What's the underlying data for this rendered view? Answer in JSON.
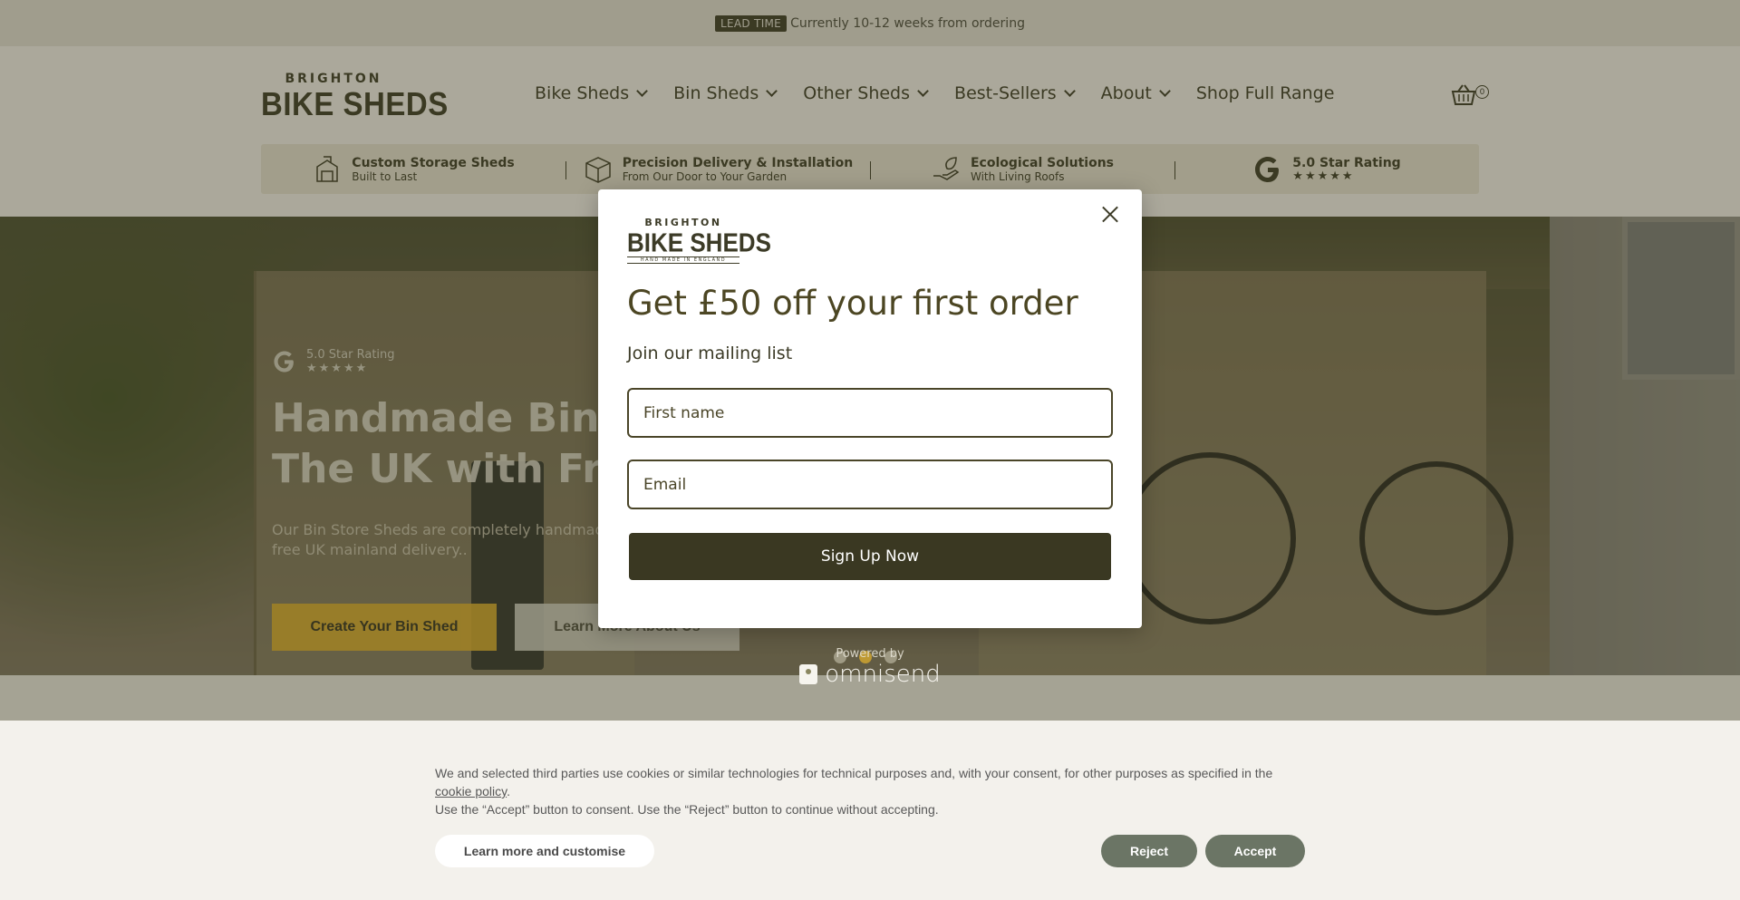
{
  "topbar": {
    "badge": "LEAD TIME",
    "text": "Currently 10-12 weeks from ordering"
  },
  "logo": {
    "small": "BRIGHTON",
    "big": "BIKE SHEDS"
  },
  "nav": {
    "items": [
      {
        "label": "Bike Sheds",
        "has_dropdown": true
      },
      {
        "label": "Bin Sheds",
        "has_dropdown": true
      },
      {
        "label": "Other Sheds",
        "has_dropdown": true
      },
      {
        "label": "Best-Sellers",
        "has_dropdown": true
      },
      {
        "label": "About",
        "has_dropdown": true
      },
      {
        "label": "Shop Full Range",
        "has_dropdown": false
      }
    ],
    "cart_count": "0"
  },
  "features": [
    {
      "icon": "storage-shed-icon",
      "title": "Custom Storage Sheds",
      "subtitle": "Built to Last"
    },
    {
      "icon": "delivery-box-icon",
      "title": "Precision Delivery & Installation",
      "subtitle": "From Our Door to Your Garden"
    },
    {
      "icon": "eco-hand-leaf-icon",
      "title": "Ecological Solutions",
      "subtitle": "With Living Roofs"
    },
    {
      "icon": "google-icon",
      "title": "5.0 Star Rating",
      "stars": "★★★★★"
    }
  ],
  "hero": {
    "rating": "5.0 Star Rating",
    "stars": "★★★★★",
    "heading_line1": "Handmade Bin She",
    "heading_line2": "The UK with Free D",
    "paragraph_line1": "Our Bin Store Sheds are completely handmade a",
    "paragraph_line2": "free UK mainland delivery..",
    "btn_primary": "Create Your Bin Shed",
    "btn_secondary": "Learn More About Us"
  },
  "modal": {
    "logo_small": "BRIGHTON",
    "logo_big": "BIKE SHEDS",
    "logo_tag": "HAND MADE IN ENGLAND",
    "heading": "Get £50 off your first order",
    "subheading": "Join our mailing list",
    "first_name_placeholder": "First name",
    "email_placeholder": "Email",
    "submit": "Sign Up Now"
  },
  "powered": {
    "label": "Powered by",
    "brand": "omnisend"
  },
  "cookie": {
    "text_line1": "We and selected third parties use cookies or similar technologies for technical purposes and, with your consent, for other purposes as specified in the",
    "policy_link": "cookie policy",
    "text_line2": "Use the “Accept” button to consent. Use the “Reject” button to continue without accepting.",
    "learn_more": "Learn more and customise",
    "reject": "Reject",
    "accept": "Accept"
  },
  "colors": {
    "brand_dark": "#3c3b27",
    "accent_yellow": "#e5b42c",
    "cookie_btn": "#6b7565"
  }
}
